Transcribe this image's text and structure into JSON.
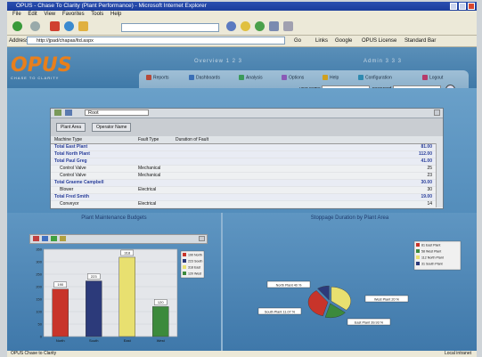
{
  "browser": {
    "title": "OPUS - Chase To Clarity (Plant Performance) - Microsoft Internet Explorer",
    "menu": [
      "File",
      "Edit",
      "View",
      "Favorites",
      "Tools",
      "Help"
    ],
    "address_label": "Address",
    "address": "http://jpad/chapas/ltd.aspx",
    "go_label": "Go",
    "links_label": "Links",
    "links": [
      "Google",
      "OPUS License",
      "Standard Bar"
    ]
  },
  "app": {
    "logo_text": "OPUS",
    "logo_tagline": "CHASE TO CLARITY",
    "faint_left": "Overview 1 2 3",
    "faint_right": "Admin 3 3 3",
    "nav": [
      {
        "label": "Reports",
        "color": "#b64a3a"
      },
      {
        "label": "Dashboards",
        "color": "#3a6fb6"
      },
      {
        "label": "Analysis",
        "color": "#3a9a5a"
      },
      {
        "label": "Options",
        "color": "#8a5ab6"
      },
      {
        "label": "Help",
        "color": "#d0a020"
      },
      {
        "label": "Configuration",
        "color": "#2f8ab0"
      },
      {
        "label": "Logout",
        "color": "#b63a6a"
      }
    ],
    "user_label": "user name",
    "password_label": "password"
  },
  "table": {
    "view": "Root",
    "group_buttons": [
      "Plant Area",
      "Operator Name"
    ],
    "headers": [
      "Machine Type",
      "Fault Type",
      "Duration of Fault"
    ],
    "rows": [
      {
        "label": "Total East Plant",
        "fault": "",
        "value": "81.00",
        "total": true
      },
      {
        "label": "Total North Plant",
        "fault": "",
        "value": "112.00",
        "total": true
      },
      {
        "label": "Total Paul Greg",
        "fault": "",
        "value": "41.00",
        "total": true
      },
      {
        "label": "Control Valve",
        "fault": "Mechanical",
        "value": "25",
        "total": false
      },
      {
        "label": "Control Valve",
        "fault": "Mechanical",
        "value": "23",
        "total": false
      },
      {
        "label": "Total Graeme Campbell",
        "fault": "",
        "value": "30.00",
        "total": true
      },
      {
        "label": "Blower",
        "fault": "Electrical",
        "value": "30",
        "total": false
      },
      {
        "label": "Total Fred Smith",
        "fault": "",
        "value": "19.00",
        "total": true
      },
      {
        "label": "Conveyor",
        "fault": "Electrical",
        "value": "14",
        "total": false
      }
    ]
  },
  "charts": {
    "budget_title": "Plant Maintenance Budgets",
    "pie_title": "Stoppage Duration by Plant Area"
  },
  "chart_data": [
    {
      "type": "bar",
      "title": "Plant Maintenance Budgets",
      "categories": [
        "North",
        "South",
        "East",
        "West"
      ],
      "values": [
        190,
        223,
        318,
        120
      ],
      "ylim": [
        0,
        350
      ],
      "yticks": [
        0,
        50,
        100,
        150,
        200,
        250,
        300,
        350
      ],
      "colors": [
        "#c8342a",
        "#2c3a7a",
        "#e8e070",
        "#3c8a3c"
      ],
      "legend": [
        "190 North",
        "223 South",
        "318 East",
        "120 West"
      ],
      "legend_position": "right"
    },
    {
      "type": "pie",
      "title": "Stoppage Duration by Plant Area",
      "labels": [
        "North Plant",
        "West Plant",
        "East Plant",
        "South Plant"
      ],
      "values": [
        40,
        20,
        39.93,
        11.07
      ],
      "slice_labels": [
        "North Plant 40 %",
        "West Plant 20 %",
        "East Plant 39.93 %",
        "South Plant 11.07 %"
      ],
      "colors": [
        "#e8e070",
        "#3c8a3c",
        "#c8342a",
        "#2c3a7a"
      ],
      "legend": [
        "81 East Plant",
        "58 West Plant",
        "112 North Plant",
        "31 South Plant"
      ],
      "legend_position": "top-right"
    }
  ],
  "status": "OPUS Chase to Clarity",
  "status_right": "Local intranet"
}
